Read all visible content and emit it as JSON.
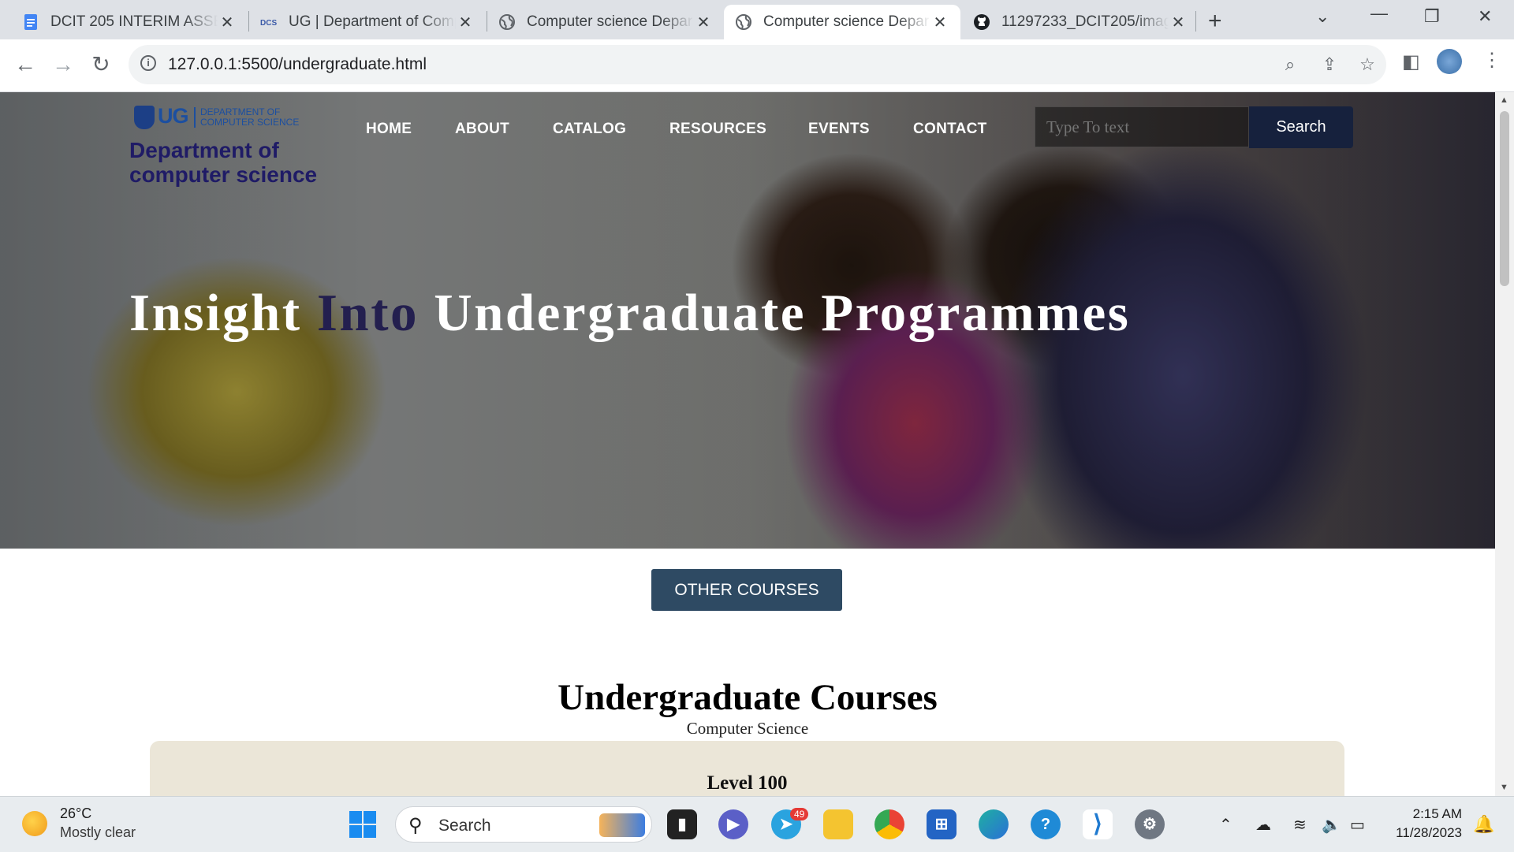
{
  "browser": {
    "tabs": [
      {
        "title": "DCIT 205 INTERIM ASSESS",
        "icon": "docs-icon",
        "active": false
      },
      {
        "title": "UG | Department of Comp",
        "icon": "dcs-icon",
        "active": false
      },
      {
        "title": "Computer science Depar",
        "icon": "globe-icon",
        "active": false
      },
      {
        "title": "Computer science Depar",
        "icon": "globe-icon",
        "active": true
      },
      {
        "title": "11297233_DCIT205/imag",
        "icon": "github-icon",
        "active": false
      }
    ],
    "url": "127.0.0.1:5500/undergraduate.html"
  },
  "site": {
    "logo": {
      "mark": "UG",
      "subtitle": "DEPARTMENT OF COMPUTER SCIENCE"
    },
    "department_name": "Department of computer science",
    "nav": [
      "HOME",
      "ABOUT",
      "CATALOG",
      "RESOURCES",
      "EVENTS",
      "CONTACT"
    ],
    "search": {
      "placeholder": "Type To text",
      "button": "Search"
    },
    "hero": {
      "headline_part1": "Insight",
      "headline_highlight": "Into",
      "headline_part2": "Undergraduate Programmes"
    },
    "other_courses_button": "OTHER COURSES",
    "courses_title": "Undergraduate Courses",
    "courses_subtitle": "Computer Science",
    "level_heading": "Level 100"
  },
  "taskbar": {
    "weather": {
      "temp": "26°C",
      "condition": "Mostly clear"
    },
    "search_label": "Search",
    "telegram_badge": "49",
    "time": "2:15 AM",
    "date": "11/28/2023"
  },
  "colors": {
    "accent_navy": "#1f1b66",
    "search_button": "#16213d",
    "other_courses_button": "#2e4a63",
    "level_box": "#ebe6d8"
  }
}
